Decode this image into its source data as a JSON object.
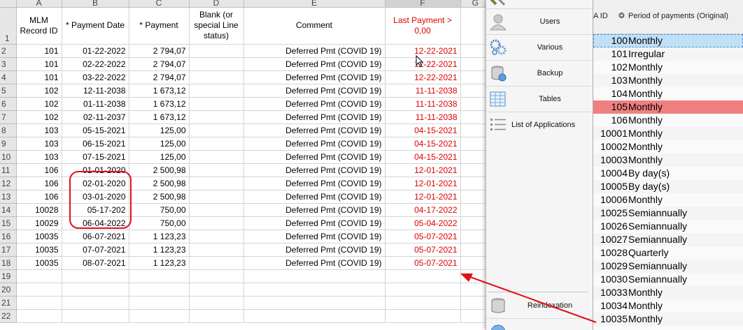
{
  "sheet": {
    "col_letters": [
      "A",
      "B",
      "C",
      "D",
      "E",
      "F",
      "G"
    ],
    "headers": {
      "a": "MLM Record ID",
      "b": "* Payment Date",
      "c": "* Payment",
      "d": "Blank (or special Line status)",
      "e": "Comment",
      "f": "Last Payment > 0,00"
    },
    "row_numbers": [
      "1",
      "2",
      "3",
      "4",
      "5",
      "6",
      "7",
      "8",
      "9",
      "10",
      "11",
      "12",
      "13",
      "14",
      "15",
      "16",
      "17",
      "18",
      "19",
      "20",
      "21",
      "22"
    ],
    "rows": [
      {
        "id": "101",
        "date": "01-22-2022",
        "pay": "2 794,07",
        "comment": "Deferred Pmt (COVID 19)",
        "last": "12-22-2021"
      },
      {
        "id": "101",
        "date": "02-22-2022",
        "pay": "2 794,07",
        "comment": "Deferred Pmt (COVID 19)",
        "last": "12-22-2021"
      },
      {
        "id": "101",
        "date": "03-22-2022",
        "pay": "2 794,07",
        "comment": "Deferred Pmt (COVID 19)",
        "last": "12-22-2021"
      },
      {
        "id": "102",
        "date": "12-11-2038",
        "pay": "1 673,12",
        "comment": "Deferred Pmt (COVID 19)",
        "last": "11-11-2038"
      },
      {
        "id": "102",
        "date": "01-11-2038",
        "pay": "1 673,12",
        "comment": "Deferred Pmt (COVID 19)",
        "last": "11-11-2038"
      },
      {
        "id": "102",
        "date": "02-11-2037",
        "pay": "1 673,12",
        "comment": "Deferred Pmt (COVID 19)",
        "last": "11-11-2038"
      },
      {
        "id": "103",
        "date": "05-15-2021",
        "pay": "125,00",
        "comment": "Deferred Pmt (COVID 19)",
        "last": "04-15-2021"
      },
      {
        "id": "103",
        "date": "06-15-2021",
        "pay": "125,00",
        "comment": "Deferred Pmt (COVID 19)",
        "last": "04-15-2021"
      },
      {
        "id": "103",
        "date": "07-15-2021",
        "pay": "125,00",
        "comment": "Deferred Pmt (COVID 19)",
        "last": "04-15-2021"
      },
      {
        "id": "106",
        "date": "01-01-2020",
        "pay": "2 500,98",
        "comment": "Deferred Pmt (COVID 19)",
        "last": "12-01-2021"
      },
      {
        "id": "106",
        "date": "02-01-2020",
        "pay": "2 500,98",
        "comment": "Deferred Pmt (COVID 19)",
        "last": "12-01-2021"
      },
      {
        "id": "106",
        "date": "03-01-2020",
        "pay": "2 500,98",
        "comment": "Deferred Pmt (COVID 19)",
        "last": "12-01-2021"
      },
      {
        "id": "10028",
        "date": "05-17-202",
        "pay": "750,00",
        "comment": "Deferred Pmt (COVID 19)",
        "last": "04-17-2022"
      },
      {
        "id": "10029",
        "date": "06-04-2022",
        "pay": "750,00",
        "comment": "Deferred Pmt (COVID 19)",
        "last": "05-04-2022"
      },
      {
        "id": "10035",
        "date": "06-07-2021",
        "pay": "1 123,23",
        "comment": "Deferred Pmt (COVID 19)",
        "last": "05-07-2021"
      },
      {
        "id": "10035",
        "date": "07-07-2021",
        "pay": "1 123,23",
        "comment": "Deferred Pmt (COVID 19)",
        "last": "05-07-2021"
      },
      {
        "id": "10035",
        "date": "08-07-2021",
        "pay": "1 123,23",
        "comment": "Deferred Pmt (COVID 19)",
        "last": "05-07-2021"
      }
    ]
  },
  "nav": {
    "items": [
      {
        "label": "Users",
        "icon": "user-icon"
      },
      {
        "label": "Various",
        "icon": "gears-icon"
      },
      {
        "label": "Backup",
        "icon": "database-backup-icon"
      },
      {
        "label": "Tables",
        "icon": "table-icon"
      },
      {
        "label": "List of Applications",
        "icon": "list-icon"
      },
      {
        "label": "Reindexation",
        "icon": "database-reindex-icon"
      }
    ]
  },
  "right_table": {
    "id_header": "A ID",
    "period_header": "Period of payments (Original)",
    "rows": [
      {
        "id": "100",
        "period": "Monthly"
      },
      {
        "id": "101",
        "period": "Irregular"
      },
      {
        "id": "102",
        "period": "Monthly"
      },
      {
        "id": "103",
        "period": "Monthly"
      },
      {
        "id": "104",
        "period": "Monthly"
      },
      {
        "id": "105",
        "period": "Monthly"
      },
      {
        "id": "106",
        "period": "Monthly"
      },
      {
        "id": "10001",
        "period": "Monthly"
      },
      {
        "id": "10002",
        "period": "Monthly"
      },
      {
        "id": "10003",
        "period": "Monthly"
      },
      {
        "id": "10004",
        "period": "By day(s)"
      },
      {
        "id": "10005",
        "period": "By day(s)"
      },
      {
        "id": "10006",
        "period": "Monthly"
      },
      {
        "id": "10025",
        "period": "Semiannually"
      },
      {
        "id": "10026",
        "period": "Semiannually"
      },
      {
        "id": "10027",
        "period": "Semiannually"
      },
      {
        "id": "10028",
        "period": "Quarterly"
      },
      {
        "id": "10029",
        "period": "Semiannually"
      },
      {
        "id": "10030",
        "period": "Semiannually"
      },
      {
        "id": "10033",
        "period": "Monthly"
      },
      {
        "id": "10034",
        "period": "Monthly"
      },
      {
        "id": "10035",
        "period": "Monthly"
      }
    ]
  },
  "colors": {
    "annotation_red": "#e0101a",
    "last_payment_red": "#e00000",
    "selected_row_blue": "#bfe0f7",
    "highlight_row_red": "#f08080"
  }
}
